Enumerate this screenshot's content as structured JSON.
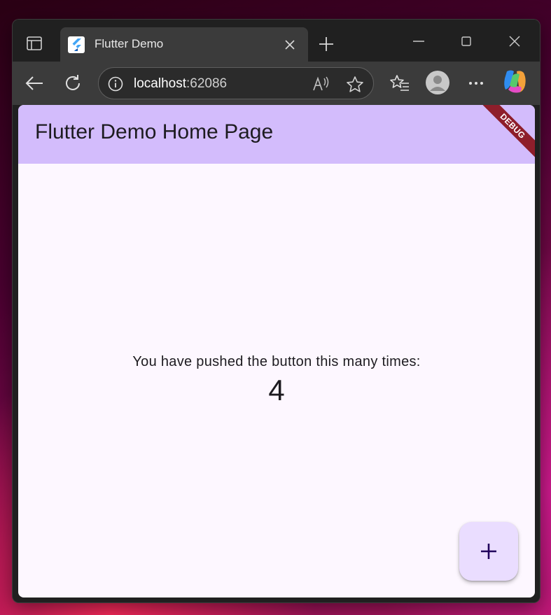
{
  "browser": {
    "tab": {
      "title": "Flutter Demo"
    },
    "address": {
      "host": "localhost",
      "port": ":62086"
    }
  },
  "app": {
    "title": "Flutter Demo Home Page",
    "debug_banner": "DEBUG",
    "counter_label": "You have pushed the button this many times:",
    "counter_value": "4"
  },
  "colors": {
    "appbar": "#d3bcfc",
    "page_background": "#fdf7ff",
    "fab": "#eaddff",
    "debug_banner": "#8e1e2b"
  },
  "icons": {
    "sidebar": "sidebar-panel-icon",
    "favicon": "flutter-logo-icon",
    "tab_close": "close-icon",
    "new_tab": "plus-icon",
    "minimize": "minimize-icon",
    "maximize": "maximize-icon",
    "close": "close-icon",
    "back": "arrow-left-icon",
    "refresh": "refresh-icon",
    "site_info": "info-icon",
    "read_aloud": "read-aloud-icon",
    "favorite": "star-icon",
    "favorites": "favorites-list-icon",
    "profile": "avatar-icon",
    "more": "more-dots-icon",
    "copilot": "copilot-icon",
    "fab": "plus-icon"
  }
}
